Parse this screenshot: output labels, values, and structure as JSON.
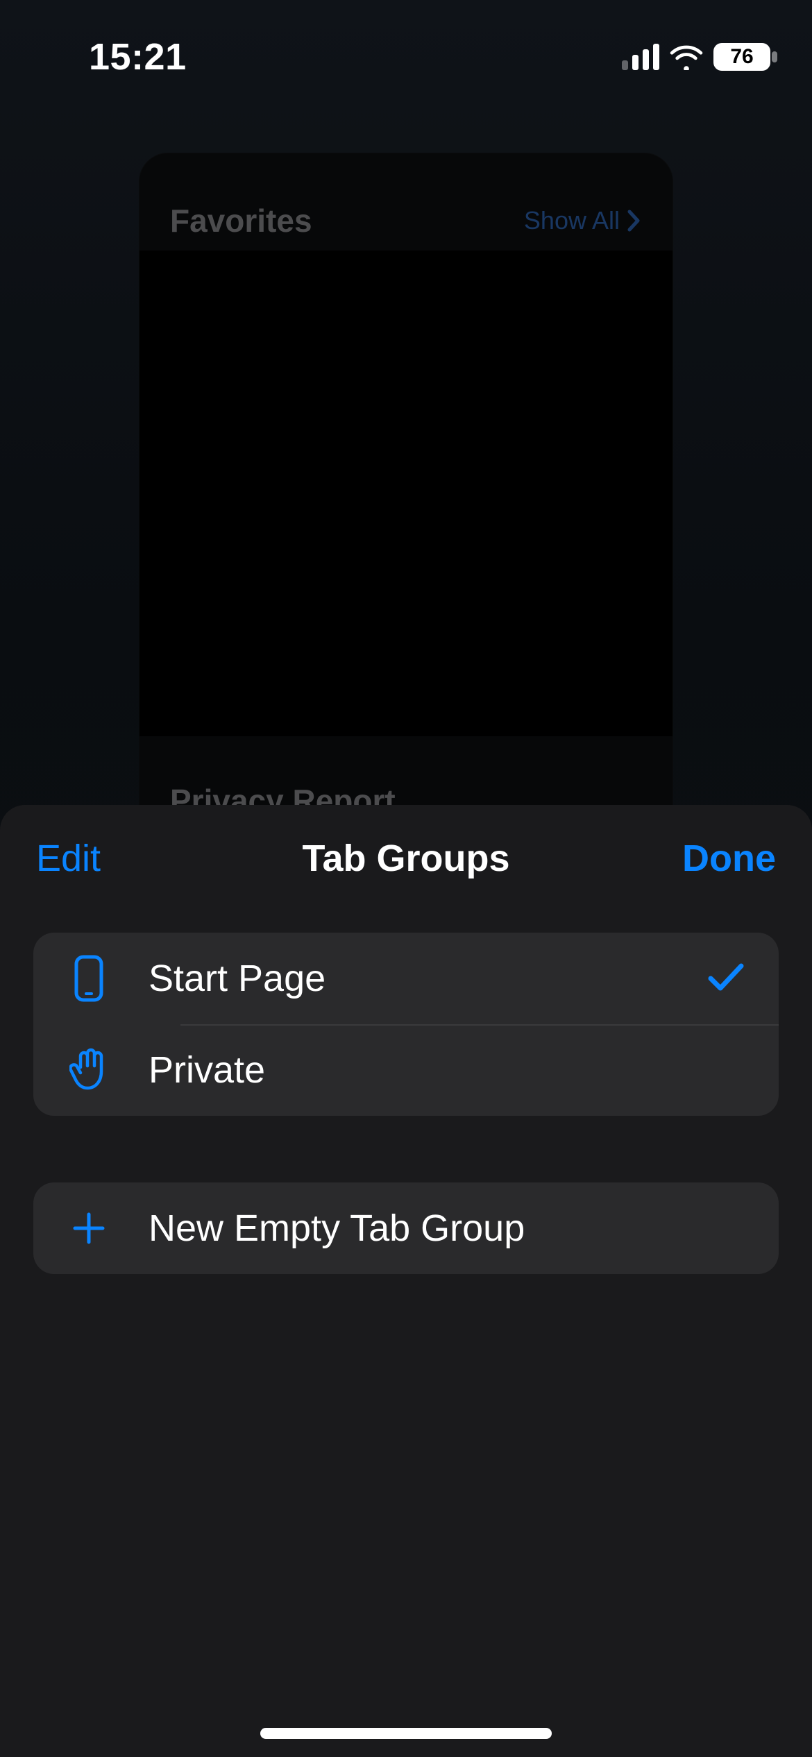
{
  "status": {
    "time": "15:21",
    "battery": "76"
  },
  "background_card": {
    "favorites_label": "Favorites",
    "show_all_label": "Show All",
    "privacy_label": "Privacy Report"
  },
  "sheet": {
    "edit_label": "Edit",
    "title": "Tab Groups",
    "done_label": "Done",
    "groups": [
      {
        "label": "Start Page",
        "selected": true
      },
      {
        "label": "Private",
        "selected": false
      }
    ],
    "new_group_label": "New Empty Tab Group"
  }
}
